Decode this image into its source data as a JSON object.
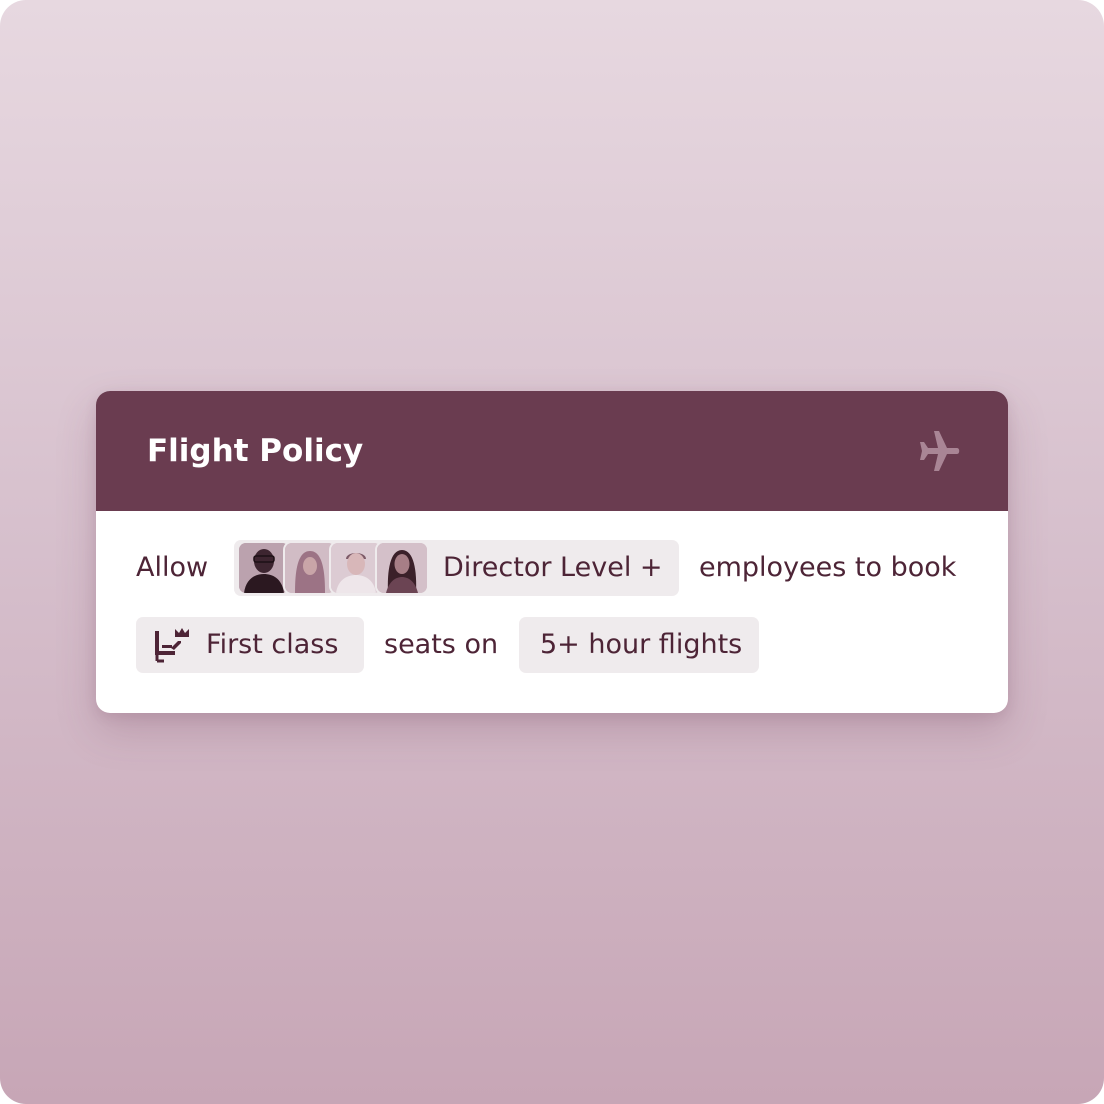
{
  "policy": {
    "title": "Flight Policy",
    "header_icon": "airplane-icon",
    "line1": {
      "prefix": "Allow",
      "group_label": "Director Level +",
      "group_avatars": [
        "avatar-person-1",
        "avatar-person-2",
        "avatar-person-3",
        "avatar-person-4"
      ],
      "suffix": "employees to book"
    },
    "line2": {
      "seat_class_icon": "first-class-seat-icon",
      "seat_class": "First class",
      "connector": "seats on",
      "duration": "5+ hour flights"
    }
  },
  "colors": {
    "header_bg": "#6a3c50",
    "text": "#4d2436",
    "pill_bg": "#efebed",
    "background_top": "#e7d8e0",
    "background_bottom": "#c7a6b6"
  }
}
